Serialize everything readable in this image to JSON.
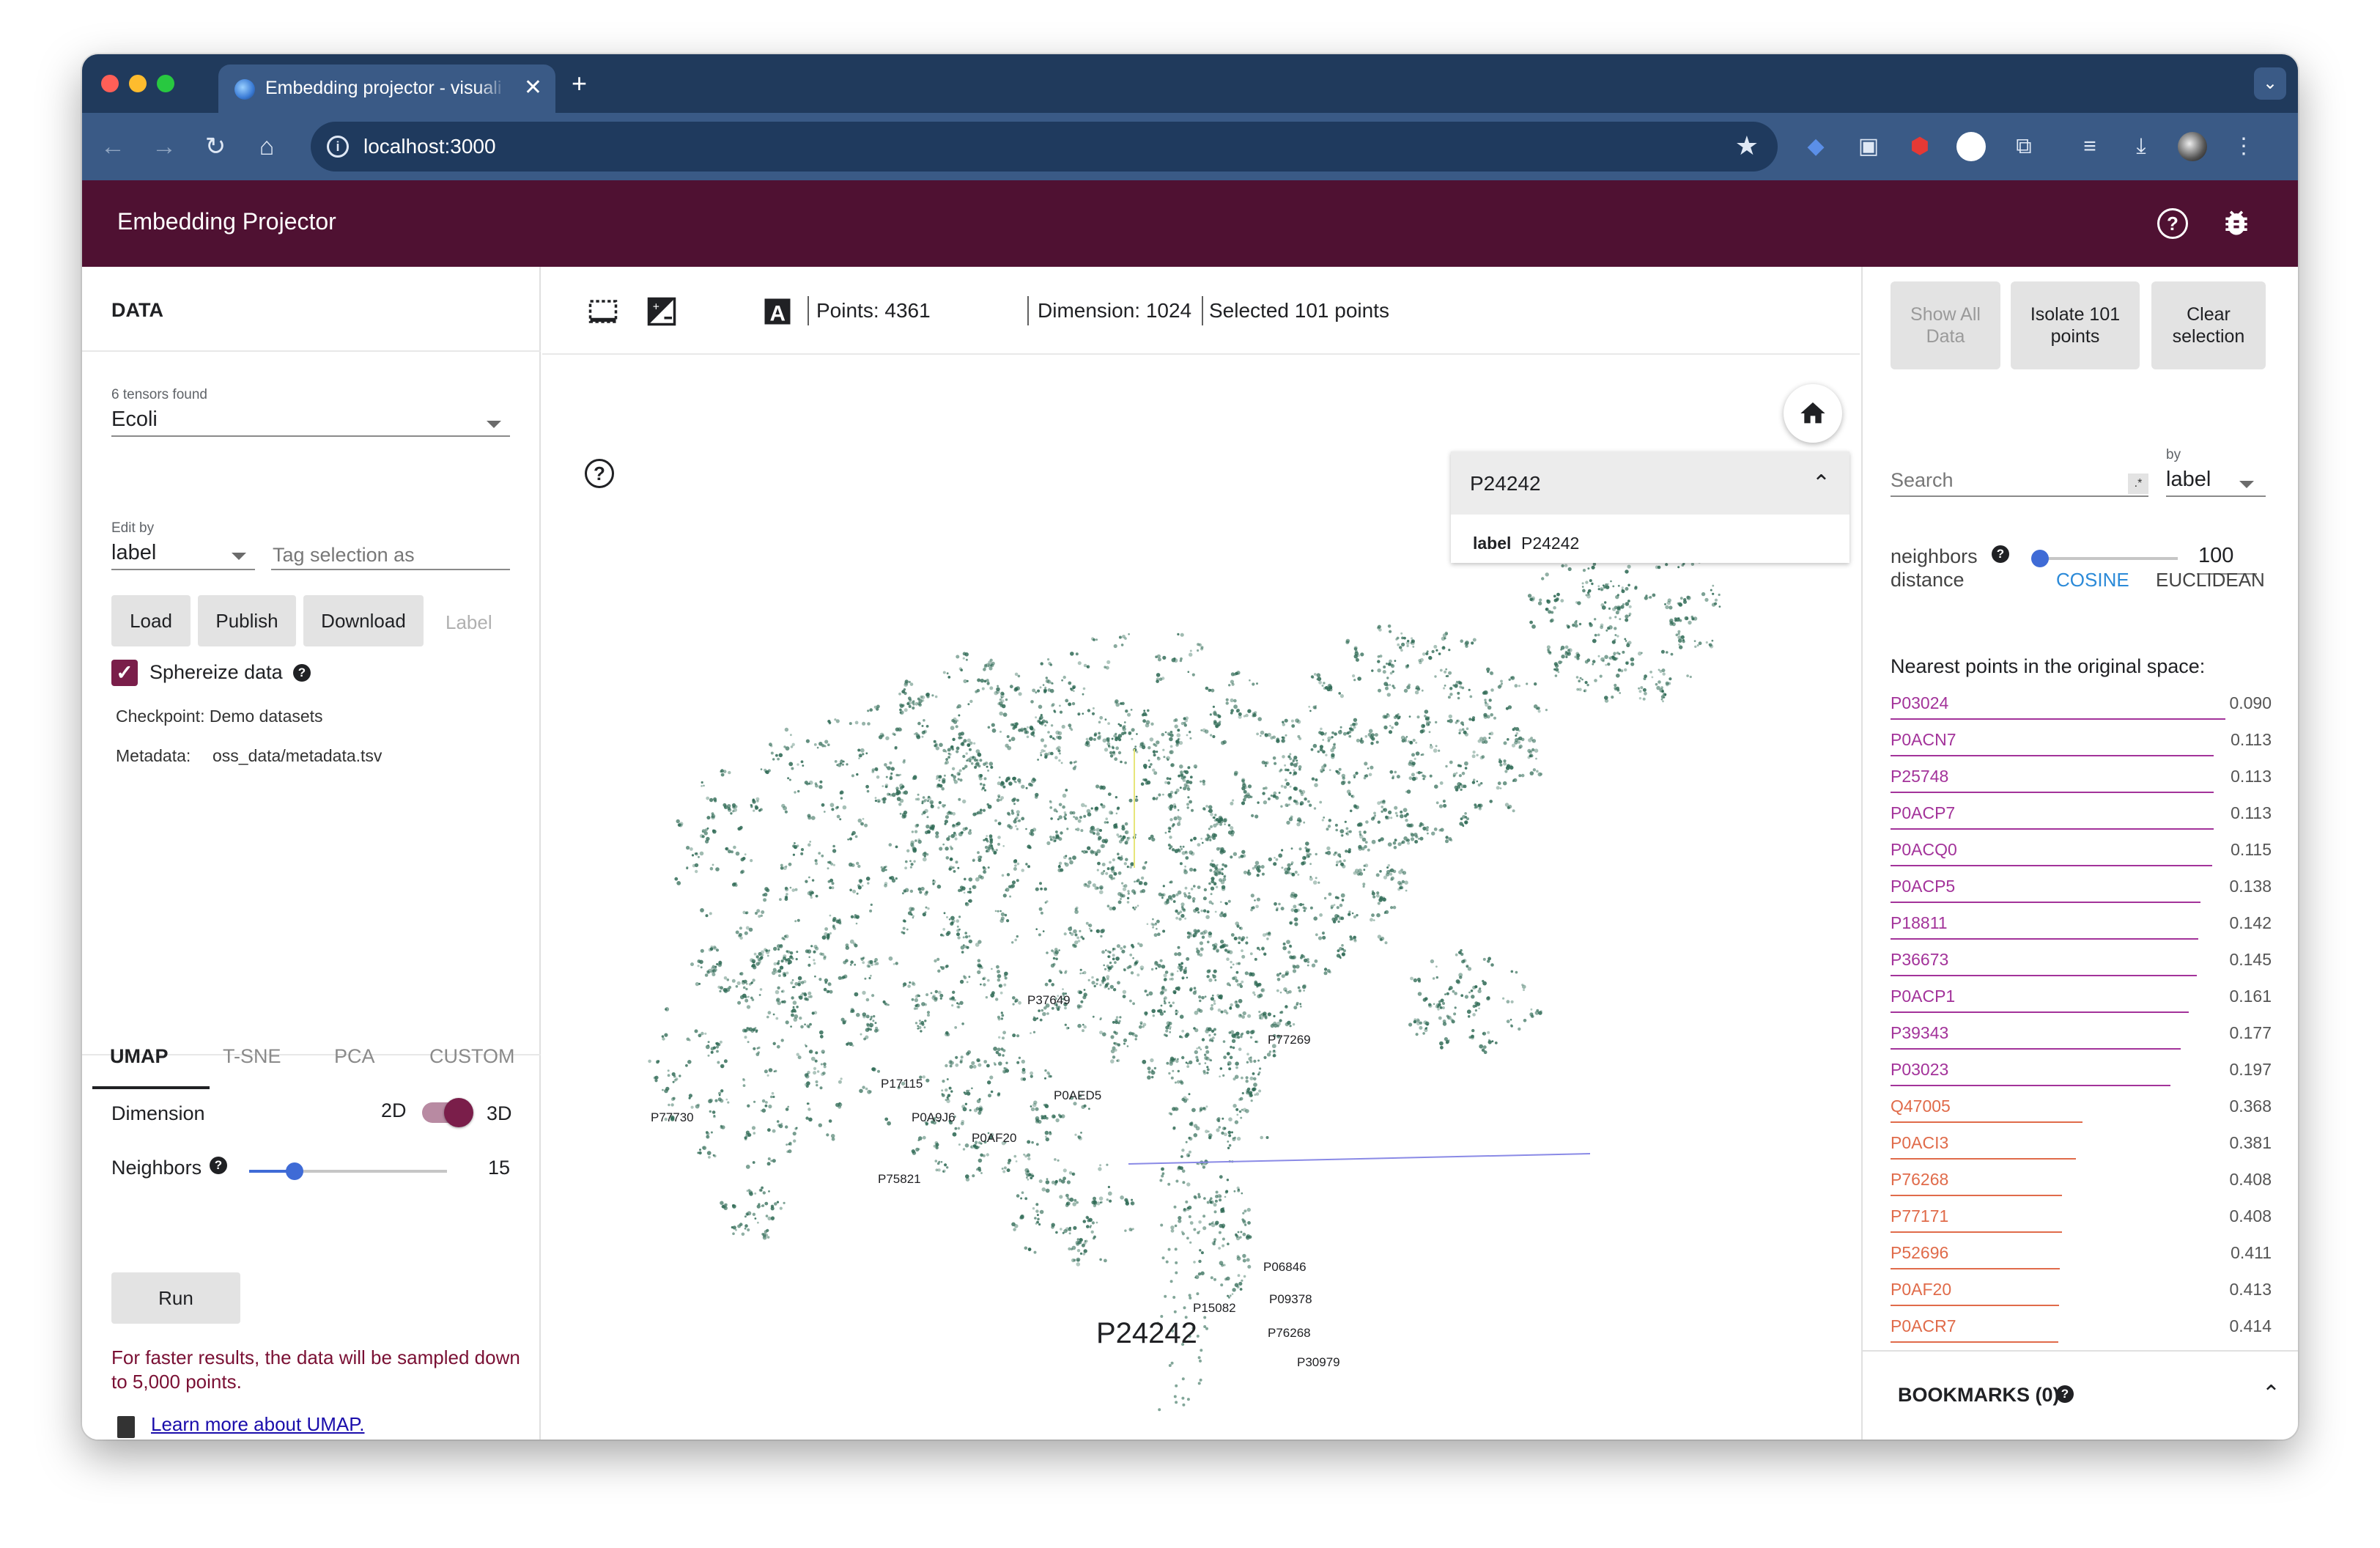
{
  "browser": {
    "tab_title": "Embedding projector - visuali",
    "tab_close": "✕",
    "new_tab": "+",
    "url": "localhost:3000"
  },
  "app": {
    "title": "Embedding Projector"
  },
  "data_panel": {
    "title": "DATA",
    "tensors_found": "6 tensors found",
    "tensor_value": "Ecoli",
    "edit_by_label": "Edit by",
    "edit_by_value": "label",
    "tag_placeholder": "Tag selection as",
    "buttons": {
      "load": "Load",
      "publish": "Publish",
      "download": "Download",
      "label": "Label"
    },
    "sphereize_label": "Sphereize data",
    "checkpoint": "Checkpoint: Demo datasets",
    "metadata_key": "Metadata:",
    "metadata_value": "oss_data/metadata.tsv"
  },
  "projection": {
    "tabs": [
      "UMAP",
      "T-SNE",
      "PCA",
      "CUSTOM"
    ],
    "active_tab": "UMAP",
    "dimension_label": "Dimension",
    "dim_2d": "2D",
    "dim_3d": "3D",
    "neighbors_label": "Neighbors",
    "neighbors_value": "15",
    "neighbors_fraction": 0.23,
    "run_label": "Run",
    "warning": "For faster results, the data will be sampled down to 5,000 points.",
    "learn_more": "Learn more about UMAP."
  },
  "center": {
    "points": "Points: 4361",
    "dimension": "Dimension: 1024",
    "selected": "Selected 101 points",
    "info_card": {
      "title": "P24242",
      "key": "label",
      "value": "P24242"
    },
    "point_labels": [
      "P37649",
      "P77269",
      "P17115",
      "P0AED5",
      "P0A9J6",
      "P77730",
      "P0AF20",
      "P75821",
      "P06846",
      "P15082",
      "P09378",
      "P76268",
      "P30979"
    ],
    "focus_label": "P24242"
  },
  "inspector": {
    "buttons": {
      "show_all_1": "Show All",
      "show_all_2": "Data",
      "isolate_1": "Isolate 101",
      "isolate_2": "points",
      "clear_1": "Clear",
      "clear_2": "selection"
    },
    "search_placeholder": "Search",
    "regex_symbol": ".*",
    "by_label": "by",
    "by_value": "label",
    "neighbors_label": "neighbors",
    "neighbors_value": "100",
    "neighbors_fraction": 0.0,
    "distance_label": "distance",
    "distance_options": [
      "COSINE",
      "EUCLIDEAN"
    ],
    "distance_selected": "COSINE",
    "nearest_title": "Nearest points in the original space:",
    "nearest": [
      {
        "label": "P03024",
        "value": "0.090"
      },
      {
        "label": "P0ACN7",
        "value": "0.113"
      },
      {
        "label": "P25748",
        "value": "0.113"
      },
      {
        "label": "P0ACP7",
        "value": "0.113"
      },
      {
        "label": "P0ACQ0",
        "value": "0.115"
      },
      {
        "label": "P0ACP5",
        "value": "0.138"
      },
      {
        "label": "P18811",
        "value": "0.142"
      },
      {
        "label": "P36673",
        "value": "0.145"
      },
      {
        "label": "P0ACP1",
        "value": "0.161"
      },
      {
        "label": "P39343",
        "value": "0.177"
      },
      {
        "label": "P03023",
        "value": "0.197"
      },
      {
        "label": "Q47005",
        "value": "0.368"
      },
      {
        "label": "P0ACI3",
        "value": "0.381"
      },
      {
        "label": "P76268",
        "value": "0.408"
      },
      {
        "label": "P77171",
        "value": "0.408"
      },
      {
        "label": "P52696",
        "value": "0.411"
      },
      {
        "label": "P0AF20",
        "value": "0.413"
      },
      {
        "label": "P0ACR7",
        "value": "0.414"
      }
    ],
    "bookmarks": "BOOKMARKS (0)"
  },
  "colors": {
    "header_bg": "#4f1132",
    "accent": "#7a1e4a",
    "slider": "#3f6bd6",
    "near_color": "#a3339a",
    "far_color": "#e06b4a",
    "point_color": "#2f6a55"
  }
}
